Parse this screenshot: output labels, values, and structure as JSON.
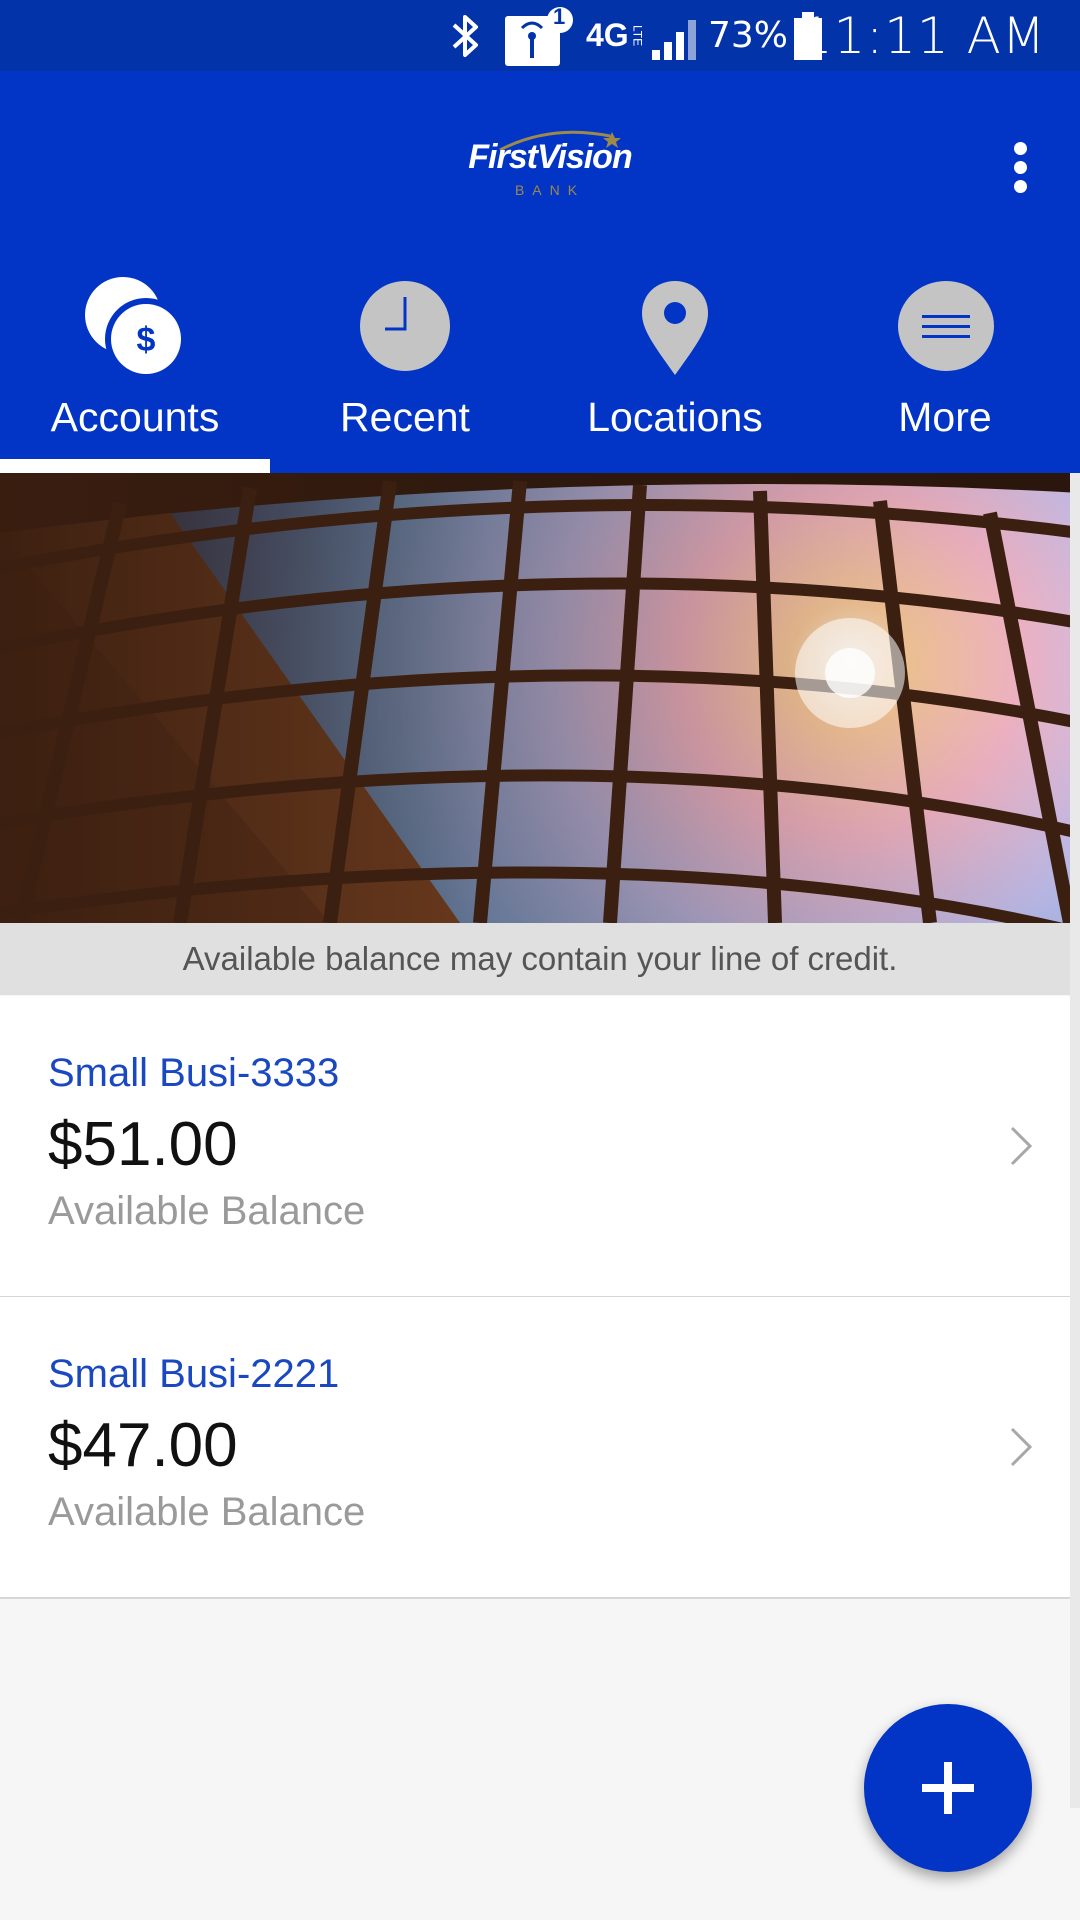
{
  "status_bar": {
    "notification_count": "1",
    "network": "4G",
    "network_sub": "LTE",
    "battery": "73%",
    "time": "11:11 AM"
  },
  "header": {
    "logo_text": "FirstVision",
    "logo_sub": "BANK"
  },
  "tabs": [
    {
      "label": "Accounts",
      "icon": "accounts-coins-icon",
      "selected": true
    },
    {
      "label": "Recent",
      "icon": "clock-icon",
      "selected": false
    },
    {
      "label": "Locations",
      "icon": "location-pin-icon",
      "selected": false
    },
    {
      "label": "More",
      "icon": "menu-icon",
      "selected": false
    }
  ],
  "notice": "Available balance may contain your line of credit.",
  "accounts": [
    {
      "name": "Small Busi-3333",
      "balance": "$51.00",
      "balance_label": "Available Balance"
    },
    {
      "name": "Small Busi-2221",
      "balance": "$47.00",
      "balance_label": "Available Balance"
    }
  ],
  "colors": {
    "brand_blue": "#0235c6",
    "status_bar": "#0233a8",
    "account_name": "#1a48c0",
    "notice_bg": "#e0e0e0"
  }
}
